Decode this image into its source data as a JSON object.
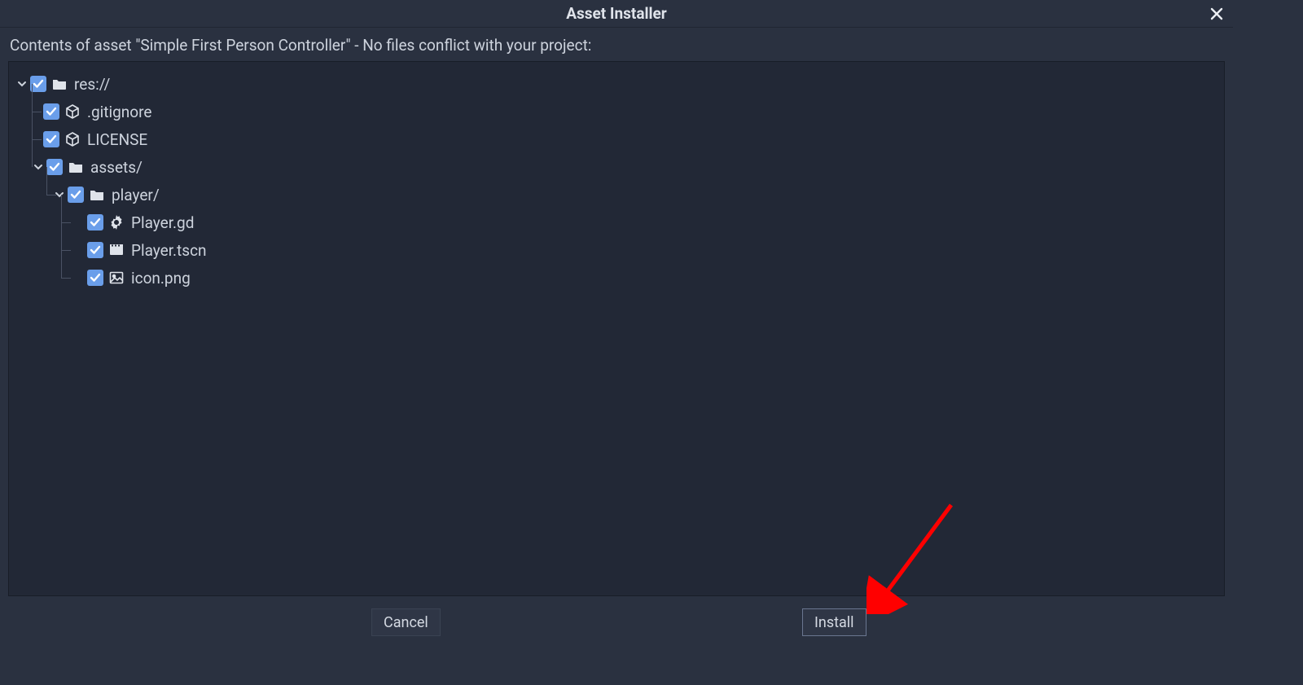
{
  "dialog": {
    "title": "Asset Installer",
    "subtitle": "Contents of asset \"Simple First Person Controller\" - No files conflict with your project:"
  },
  "tree": {
    "root": {
      "label": "res://",
      "icon": "folder-icon",
      "checked": true,
      "expanded": true
    },
    "items": [
      {
        "label": ".gitignore",
        "icon": "box-icon",
        "checked": true,
        "depth": 1
      },
      {
        "label": "LICENSE",
        "icon": "box-icon",
        "checked": true,
        "depth": 1
      },
      {
        "label": "assets/",
        "icon": "folder-icon",
        "checked": true,
        "depth": 1,
        "expanded": true,
        "folder": true
      },
      {
        "label": "player/",
        "icon": "folder-icon",
        "checked": true,
        "depth": 2,
        "expanded": true,
        "folder": true
      },
      {
        "label": "Player.gd",
        "icon": "gear-icon",
        "checked": true,
        "depth": 3
      },
      {
        "label": "Player.tscn",
        "icon": "scene-icon",
        "checked": true,
        "depth": 3
      },
      {
        "label": "icon.png",
        "icon": "image-icon",
        "checked": true,
        "depth": 3
      }
    ]
  },
  "buttons": {
    "cancel": "Cancel",
    "install": "Install"
  },
  "colors": {
    "bg": "#2a3140",
    "panel": "#222836",
    "checkbox": "#6a9eea",
    "text": "#cdd3dd",
    "arrow": "#ff0000"
  }
}
